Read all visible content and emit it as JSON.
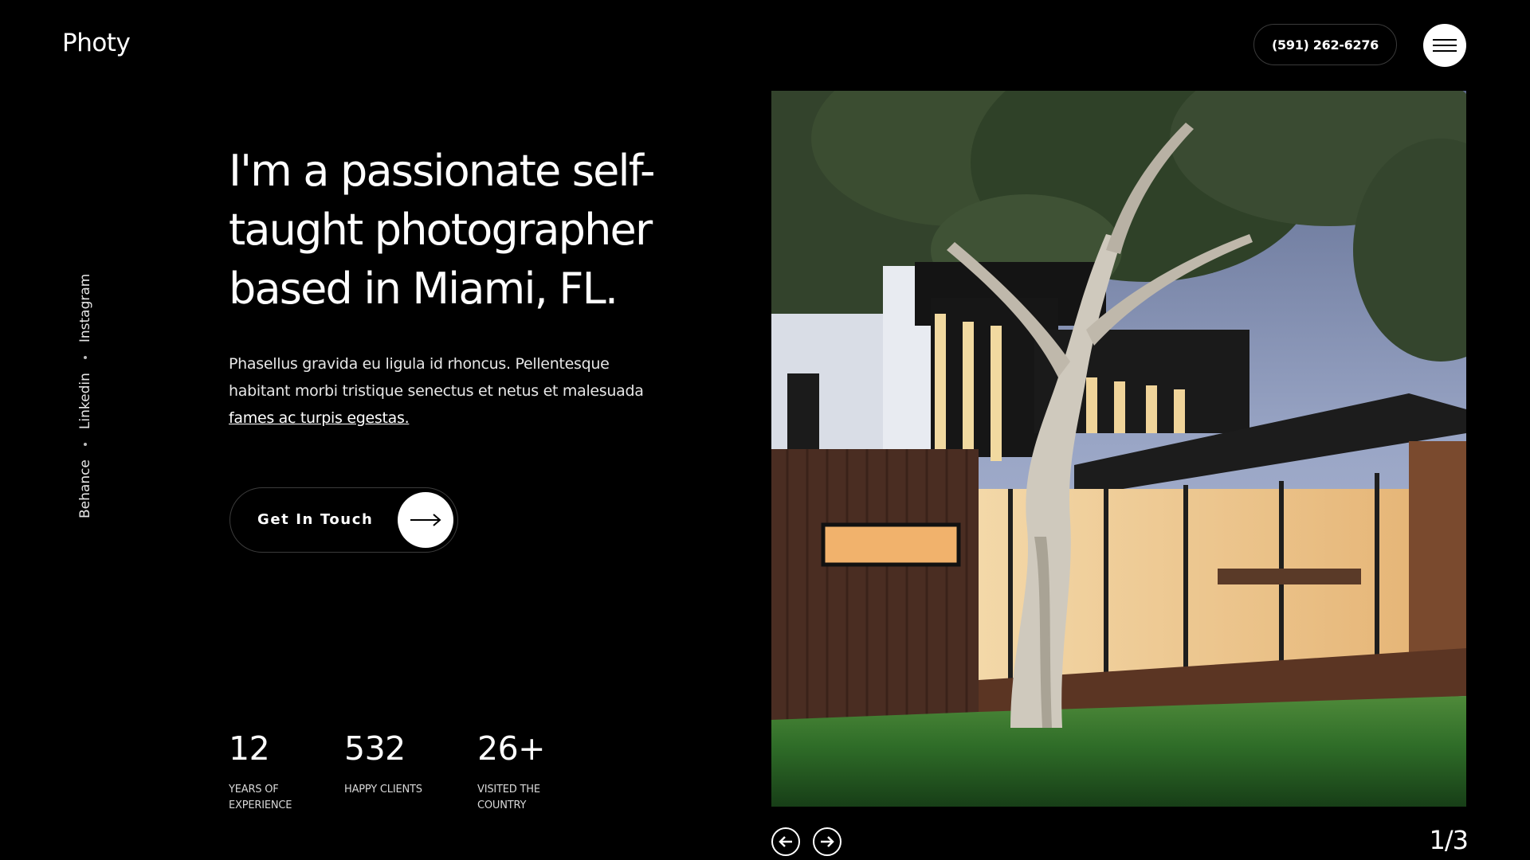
{
  "brand": {
    "logo": "Photy"
  },
  "header": {
    "phone": "(591) 262-6276",
    "menu_icon": "hamburger-icon"
  },
  "social": [
    "Instagram",
    "Linkedin",
    "Behance"
  ],
  "hero": {
    "headline_lines": [
      "I'm a passionate self-",
      "taught photographer",
      "based in Miami, FL."
    ],
    "description": "Phasellus gravida eu ligula id rhoncus. Pellentesque habitant morbi tristique senectus et netus et malesuada",
    "description_link": "fames ac turpis egestas.",
    "cta_label": "Get In Touch",
    "cta_icon": "arrow-right-icon"
  },
  "stats": [
    {
      "number": "12",
      "label_lines": [
        "YEARS OF",
        "EXPERIENCE"
      ]
    },
    {
      "number": "532",
      "label_lines": [
        "HAPPY CLIENTS"
      ]
    },
    {
      "number": "26+",
      "label_lines": [
        "VISITED THE",
        "COUNTRY"
      ]
    }
  ],
  "slider": {
    "prev_icon": "arrow-left-circle-icon",
    "next_icon": "arrow-right-circle-icon",
    "counter": "1/3"
  }
}
